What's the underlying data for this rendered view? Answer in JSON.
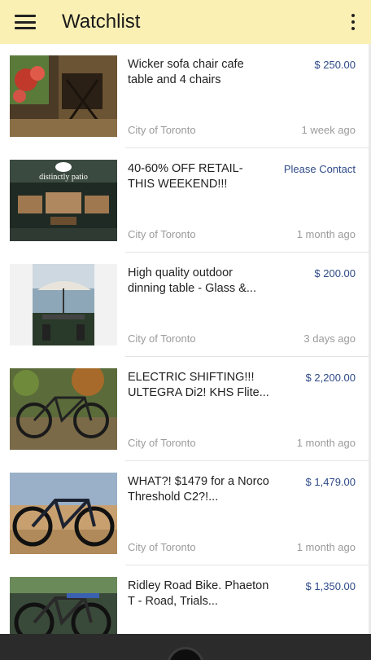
{
  "app_bar": {
    "title": "Watchlist",
    "menu_icon": "hamburger-menu-icon",
    "overflow_icon": "more-vert-icon",
    "background": "#fbf0b4"
  },
  "colors": {
    "price": "#2e4a87",
    "meta": "#9b9b9b"
  },
  "items": [
    {
      "title": "Wicker sofa chair cafe table and 4 chairs",
      "price": "$ 250.00",
      "location": "City of Toronto",
      "time": "1 week ago"
    },
    {
      "title": "40-60% OFF RETAIL- THIS WEEKEND!!!",
      "price": "Please Contact",
      "location": "City of Toronto",
      "time": "1 month ago",
      "thumb_text": "distinctly patio"
    },
    {
      "title": "High quality outdoor dinning table - Glass &...",
      "price": "$ 200.00",
      "location": "City of Toronto",
      "time": "3 days ago"
    },
    {
      "title": "ELECTRIC SHIFTING!!! ULTEGRA Di2! KHS Flite...",
      "price": "$ 2,200.00",
      "location": "City of Toronto",
      "time": "1 month ago"
    },
    {
      "title": "WHAT?! $1479 for a Norco Threshold C2?!...",
      "price": "$ 1,479.00",
      "location": "City of Toronto",
      "time": "1 month ago"
    },
    {
      "title": "Ridley Road Bike. Phaeton T - Road, Trials...",
      "price": "$ 1,350.00",
      "location": "",
      "time": ""
    }
  ]
}
